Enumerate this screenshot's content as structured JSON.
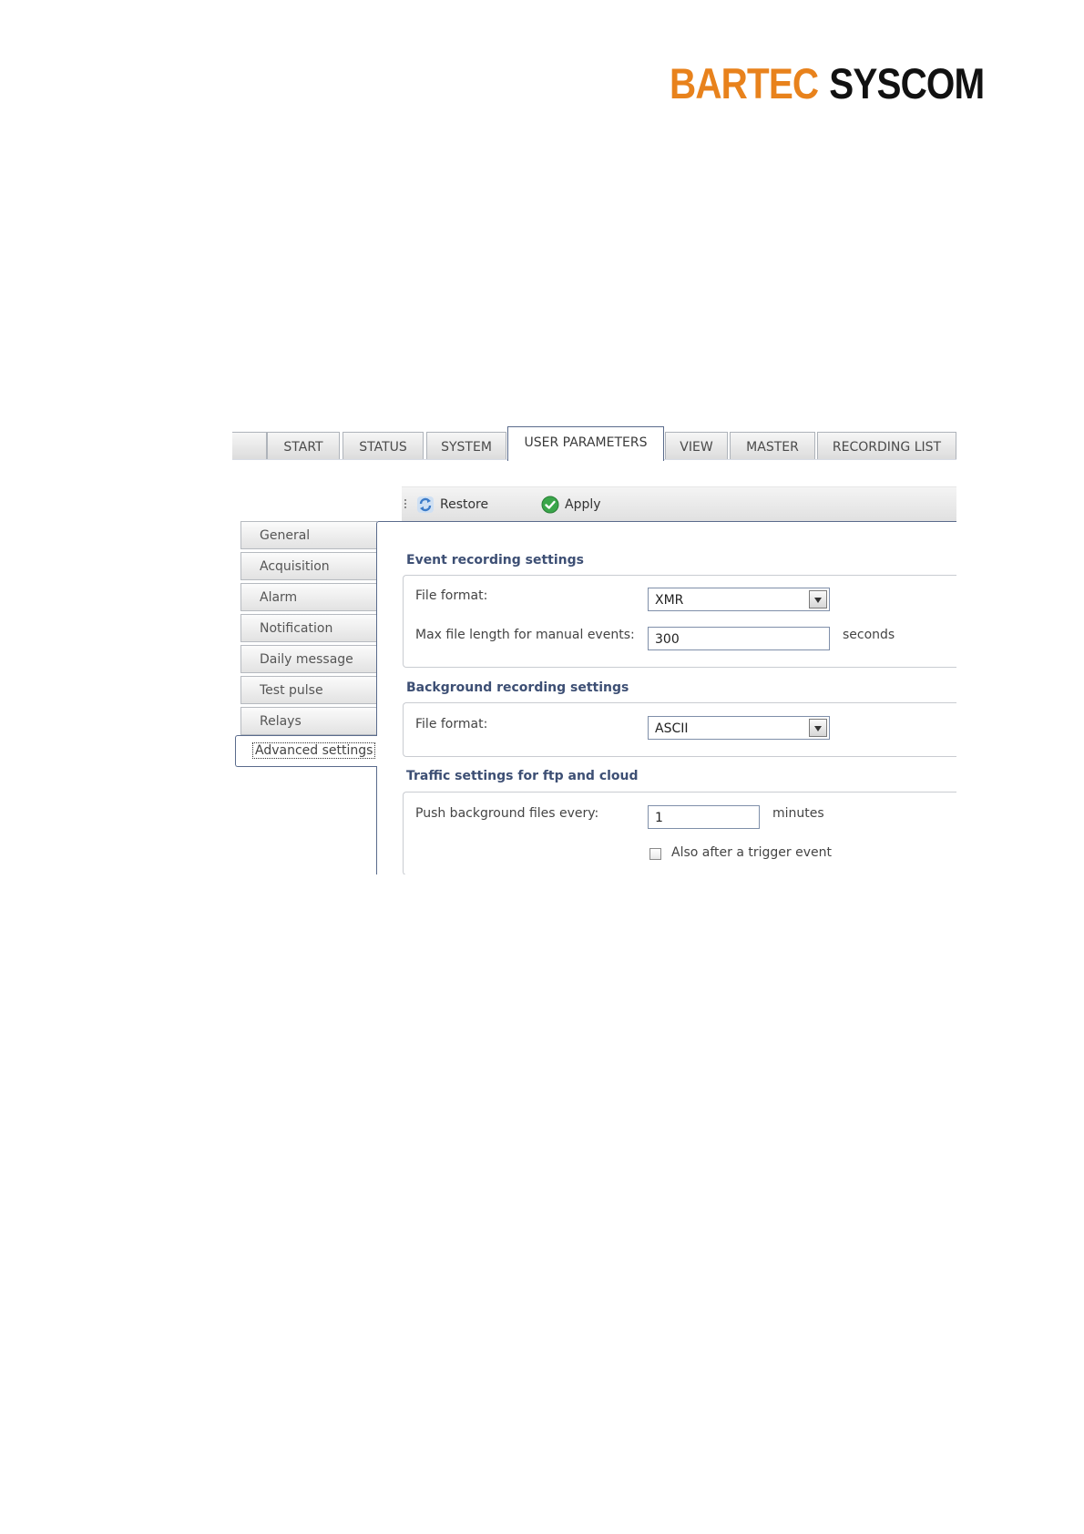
{
  "logo": {
    "word1": "BARTEC",
    "word2": "SYSCOM",
    "colors": {
      "word1": "#e8821c",
      "word2": "#111111"
    }
  },
  "tabs": [
    {
      "label": "START"
    },
    {
      "label": "STATUS"
    },
    {
      "label": "SYSTEM"
    },
    {
      "label": "USER PARAMETERS",
      "active": true
    },
    {
      "label": "VIEW"
    },
    {
      "label": "MASTER"
    },
    {
      "label": "RECORDING LIST"
    }
  ],
  "toolbar": {
    "restore": {
      "label": "Restore",
      "icon": "refresh-icon"
    },
    "apply": {
      "label": "Apply",
      "icon": "check-icon"
    }
  },
  "sidebar": {
    "items": [
      {
        "label": "General"
      },
      {
        "label": "Acquisition"
      },
      {
        "label": "Alarm"
      },
      {
        "label": "Notification"
      },
      {
        "label": "Daily message"
      },
      {
        "label": "Test pulse"
      },
      {
        "label": "Relays"
      },
      {
        "label": "Advanced settings",
        "active": true
      }
    ]
  },
  "event_recording": {
    "title": "Event recording settings",
    "file_format_label": "File format:",
    "file_format_value": "XMR",
    "max_length_label": "Max file length for manual events:",
    "max_length_value": "300",
    "max_length_unit": "seconds"
  },
  "background_recording": {
    "title": "Background recording settings",
    "file_format_label": "File format:",
    "file_format_value": "ASCII"
  },
  "traffic": {
    "title": "Traffic settings for ftp and cloud",
    "push_label": "Push background files every:",
    "push_value": "1",
    "push_unit": "minutes",
    "trigger_label": "Also after a trigger event",
    "trigger_checked": false
  },
  "colors": {
    "accent": "#5a6b8c",
    "section_title": "#3d4f74",
    "apply_green": "#3aa64a",
    "restore_blue": "#3d7cc9"
  }
}
